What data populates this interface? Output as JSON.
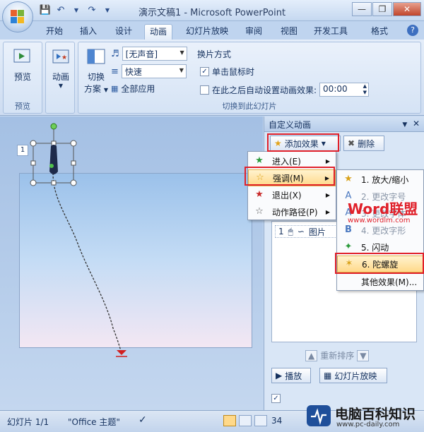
{
  "window": {
    "title": "演示文稿1 - Microsoft PowerPoint"
  },
  "tabs": [
    "开始",
    "插入",
    "设计",
    "动画",
    "幻灯片放映",
    "审阅",
    "视图",
    "开发工具",
    "格式"
  ],
  "ribbon": {
    "preview": {
      "button": "预览",
      "group": "预览"
    },
    "animation": {
      "button": "动画"
    },
    "transition": {
      "scheme_line1": "切换",
      "scheme_line2": "方案",
      "sound_value": "[无声音]",
      "speed_value": "快速",
      "apply_all": "全部应用",
      "advance_title": "换片方式",
      "on_click": "单击鼠标时",
      "after_label": "在此之后自动设置动画效果:",
      "after_value": "00:00",
      "group": "切换到此幻灯片"
    }
  },
  "slide_panel": {
    "slide_number": "1"
  },
  "pane": {
    "title": "自定义动画",
    "add_effect": "添加效果",
    "remove": "删除",
    "list_item_num": "1",
    "list_item_label": "图片",
    "reorder": "重新排序",
    "play": "播放",
    "slideshow": "幻灯片放映"
  },
  "effect_menu": [
    {
      "label": "进入(E)"
    },
    {
      "label": "强调(M)"
    },
    {
      "label": "退出(X)"
    },
    {
      "label": "动作路径(P)"
    }
  ],
  "emphasis_menu": [
    {
      "label": "1. 放大/缩小"
    },
    {
      "label": "2. 更改字号"
    },
    {
      "label": "3. 更改字体"
    },
    {
      "label": "4. 更改字形"
    },
    {
      "label": "5. 闪动"
    },
    {
      "label": "6. 陀螺旋"
    },
    {
      "label": "其他效果(M)..."
    }
  ],
  "watermark": {
    "brand": "Word联盟",
    "url": "www.wordlm.com"
  },
  "status": {
    "slide": "幻灯片 1/1",
    "theme": "\"Office 主题\"",
    "zoom": "34"
  },
  "logo": {
    "name": "电脑百科知识",
    "url": "www.pc-daily.com"
  },
  "colors": {
    "highlight_box": "#e0202a",
    "menu_hover": "#ffd98a",
    "accent": "#3d6fc0"
  }
}
